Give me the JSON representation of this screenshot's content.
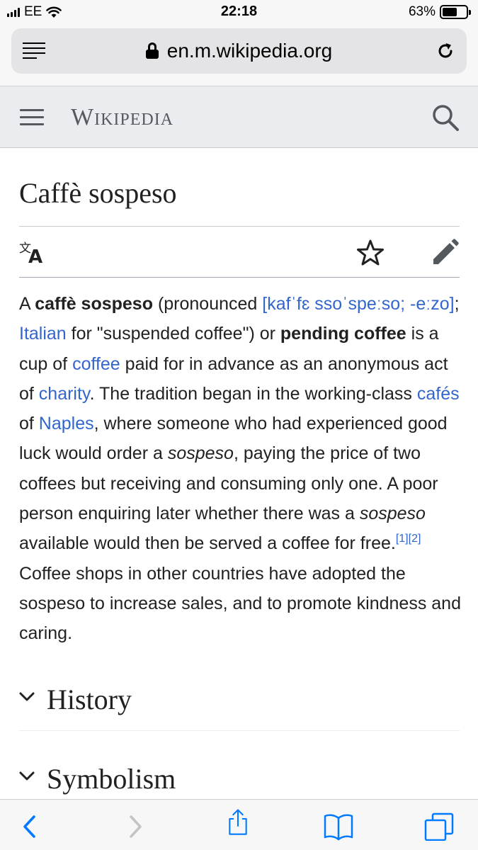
{
  "status_bar": {
    "carrier": "EE",
    "time": "22:18",
    "battery_percent": "63%",
    "battery_level": 0.63
  },
  "browser": {
    "url": "en.m.wikipedia.org"
  },
  "wiki_header": {
    "wordmark": "Wikipedia"
  },
  "article": {
    "title": "Caffè sospeso",
    "intro": {
      "p1": "A ",
      "b1": "caffè sospeso",
      "p2": " (pronounced ",
      "l_ipa": "[kafˈfɛ ssoˈspeːso; -eːzo]",
      "p3": "; ",
      "l_italian": "Italian",
      "p4": " for \"suspended coffee\") or ",
      "b2": "pending coffee",
      "p5": " is a cup of ",
      "l_coffee": "coffee",
      "p6": " paid for in advance as an anonymous act of ",
      "l_charity": "charity",
      "p7": ". The tradition began in the working-class ",
      "l_cafes": "cafés",
      "p8": " of ",
      "l_naples": "Naples",
      "p9": ", where someone who had experienced good luck would order a ",
      "i1": "sospeso",
      "p10": ", paying the price of two coffees but receiving and consuming only one. A poor person enquiring later whether there was a ",
      "i2": "sospeso",
      "p11": " available would then be served a coffee for free.",
      "ref1": "[1]",
      "ref2": "[2]",
      "p12": " Coffee shops in other countries have adopted the sospeso to increase sales, and to promote kindness and caring."
    },
    "sections": [
      {
        "title": "History"
      },
      {
        "title": "Symbolism"
      }
    ]
  },
  "icons": {
    "reader": "reader-view-icon",
    "lock": "lock-icon",
    "reload": "reload-icon",
    "menu": "hamburger-menu-icon",
    "search": "search-icon",
    "language": "language-icon",
    "watch": "star-icon",
    "edit": "pencil-edit-icon",
    "back": "chevron-left-icon",
    "forward": "chevron-right-icon",
    "share": "share-icon",
    "bookmarks": "open-book-icon",
    "tabs": "tabs-icon"
  },
  "colors": {
    "link": "#3366cc",
    "text": "#202122",
    "header_bg": "#eaecf0",
    "ios_blue": "#007aff"
  }
}
